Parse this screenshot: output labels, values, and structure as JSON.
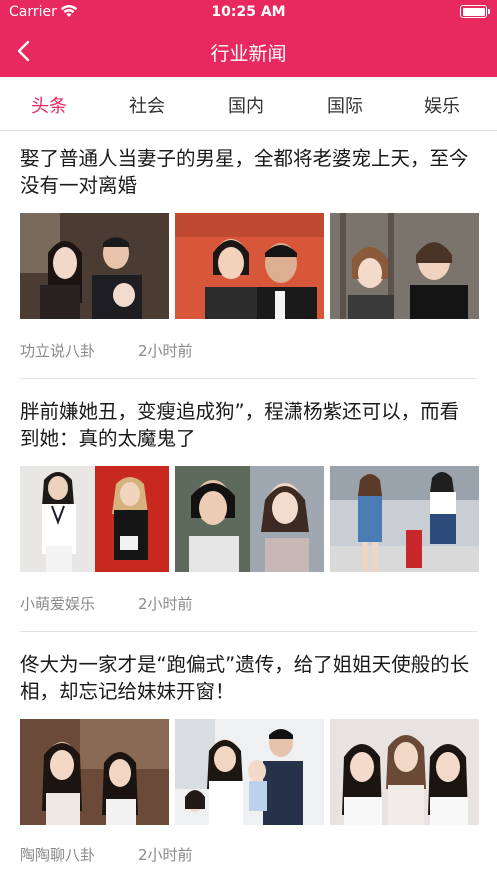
{
  "status_bar": {
    "carrier": "Carrier",
    "time": "10:25 AM",
    "battery_level": 1.0
  },
  "nav": {
    "title": "行业新闻",
    "back_icon": "chevron-left-icon"
  },
  "tabs": [
    {
      "label": "头条",
      "active": true
    },
    {
      "label": "社会",
      "active": false
    },
    {
      "label": "国内",
      "active": false
    },
    {
      "label": "国际",
      "active": false
    },
    {
      "label": "娱乐",
      "active": false
    }
  ],
  "articles": [
    {
      "headline": "娶了普通人当妻子的男星，全都将老婆宠上天，至今没有一对离婚",
      "source": "功立说八卦",
      "time": "2小时前"
    },
    {
      "headline": "胖前嫌她丑，变瘦追成狗”，程潇杨紫还可以，而看到她：真的太魔鬼了",
      "source": "小萌爱娱乐",
      "time": "2小时前"
    },
    {
      "headline": "佟大为一家才是“跑偏式”遗传，给了姐姐天使般的长相，却忘记给妹妹开窗！",
      "source": "陶陶聊八卦",
      "time": "2小时前"
    }
  ],
  "colors": {
    "brand": "#e8295f",
    "active_tab": "#e8295f",
    "meta_text": "#8a8a8a"
  }
}
